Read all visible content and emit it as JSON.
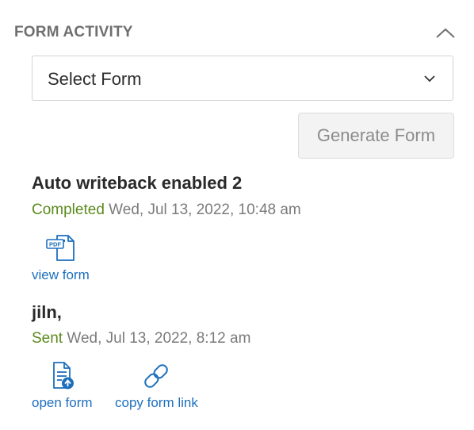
{
  "section": {
    "title": "FORM ACTIVITY",
    "collapse_icon": "chevron-up-icon"
  },
  "form_select": {
    "selected": "Select Form",
    "chevron_icon": "chevron-down-icon"
  },
  "generate_button": {
    "label": "Generate Form",
    "state": "disabled"
  },
  "activities": [
    {
      "title": "Auto writeback enabled 2",
      "status": "Completed",
      "timestamp": "Wed, Jul 13, 2022, 10:48 am",
      "actions": [
        {
          "label": "view form",
          "icon": "pdf-document-icon"
        }
      ]
    },
    {
      "title": "jiln,",
      "status": "Sent",
      "timestamp": "Wed, Jul 13, 2022, 8:12 am",
      "actions": [
        {
          "label": "open form",
          "icon": "document-upload-icon"
        },
        {
          "label": "copy form link",
          "icon": "link-icon"
        }
      ]
    }
  ],
  "colors": {
    "status": "#5b8a1c",
    "link": "#1d6fbd",
    "muted": "#7b7b7b"
  }
}
